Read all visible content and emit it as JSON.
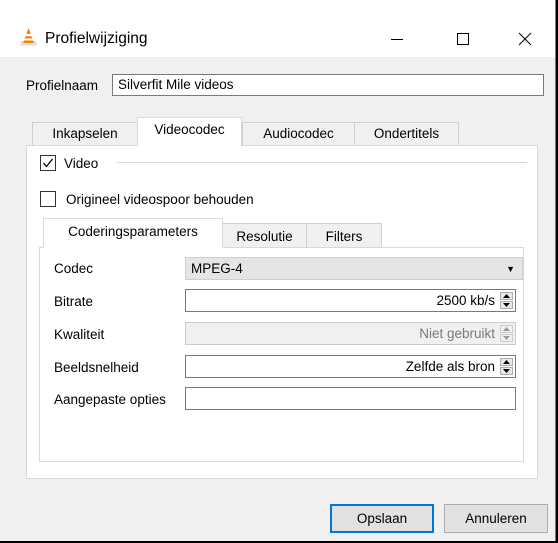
{
  "window": {
    "title": "Profielwijziging"
  },
  "profile": {
    "name_label": "Profielnaam",
    "name_value": "Silverfit Mile videos"
  },
  "outer_tabs": [
    {
      "label": "Inkapselen",
      "active": false
    },
    {
      "label": "Videocodec",
      "active": true
    },
    {
      "label": "Audiocodec",
      "active": false
    },
    {
      "label": "Ondertitels",
      "active": false
    }
  ],
  "video_group": {
    "video_label": "Video",
    "video_checked": true,
    "keep_original_label": "Origineel videospoor behouden",
    "keep_original_checked": false
  },
  "inner_tabs": [
    {
      "label": "Coderingsparameters",
      "active": true
    },
    {
      "label": "Resolutie",
      "active": false
    },
    {
      "label": "Filters",
      "active": false
    }
  ],
  "params": {
    "codec_label": "Codec",
    "codec_value": "MPEG-4",
    "bitrate_label": "Bitrate",
    "bitrate_value": "2500 kb/s",
    "quality_label": "Kwaliteit",
    "quality_value": "Niet gebruikt",
    "framerate_label": "Beeldsnelheid",
    "framerate_value": "Zelfde als bron",
    "custom_label": "Aangepaste opties",
    "custom_value": ""
  },
  "buttons": {
    "save": "Opslaan",
    "cancel": "Annuleren"
  },
  "colors": {
    "accent": "#0078d7",
    "cone_orange": "#f28500"
  },
  "icons": {
    "app": "vlc-cone-icon",
    "minimize": "minimize-icon",
    "maximize": "maximize-icon",
    "close": "close-icon",
    "dropdown": "chevron-down-icon",
    "spin": "spin-updown-icon",
    "check": "checkmark-icon"
  }
}
